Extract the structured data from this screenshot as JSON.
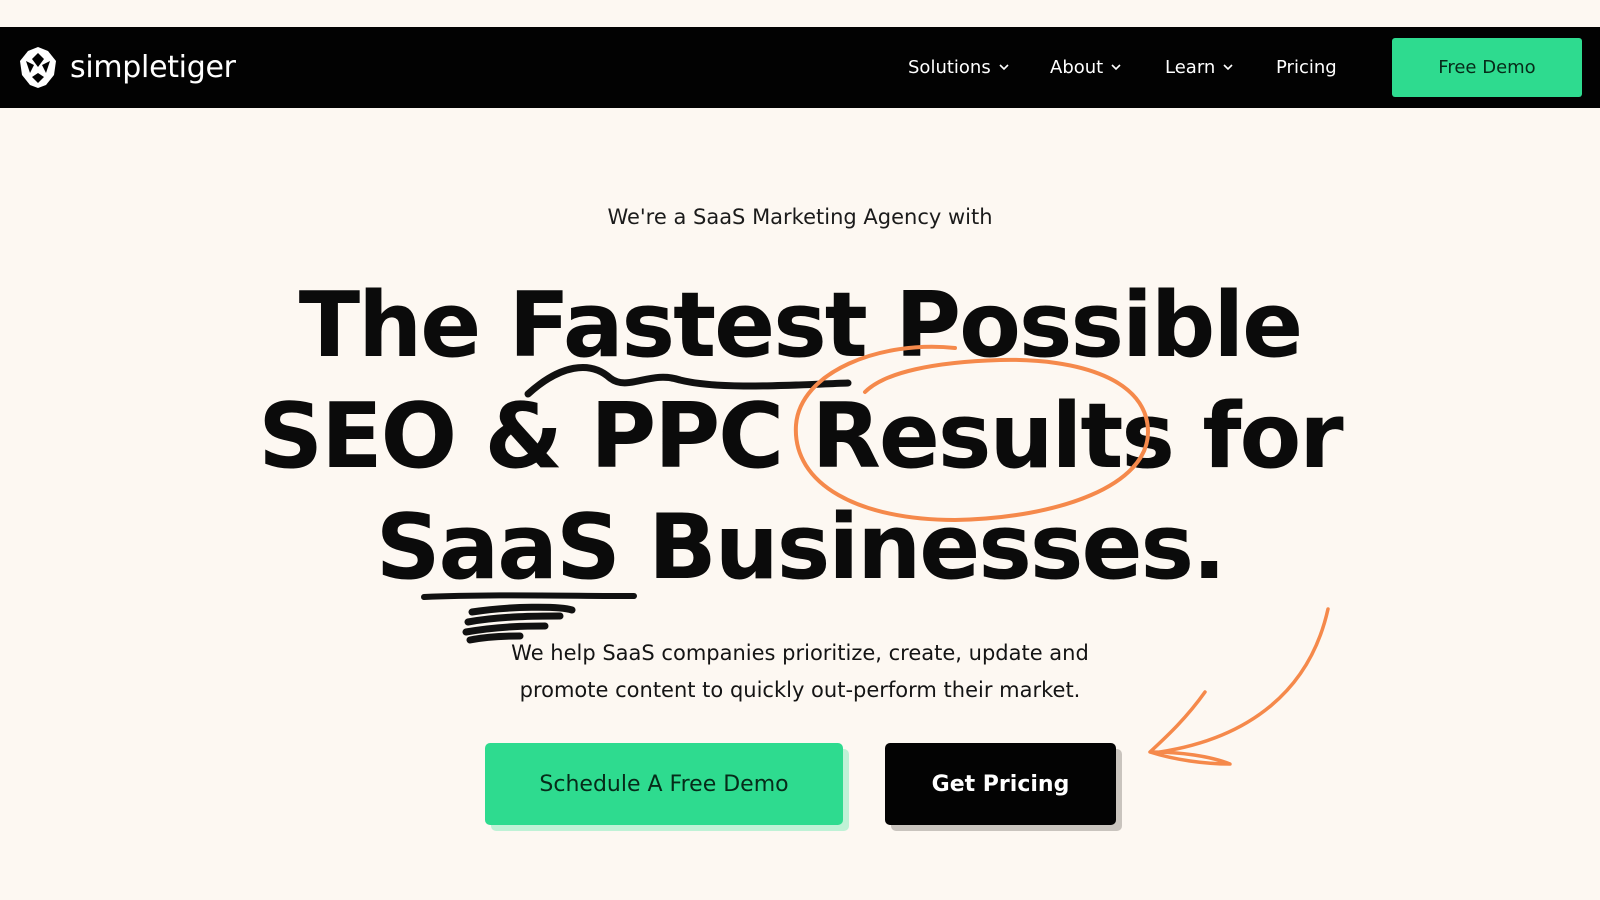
{
  "brand": {
    "name": "simpletiger",
    "logo_icon": "tiger-head-icon"
  },
  "nav": {
    "items": [
      {
        "label": "Solutions",
        "has_dropdown": true
      },
      {
        "label": "About",
        "has_dropdown": true
      },
      {
        "label": "Learn",
        "has_dropdown": true
      },
      {
        "label": "Pricing",
        "has_dropdown": false
      }
    ],
    "cta_label": "Free Demo"
  },
  "hero": {
    "eyebrow": "We're a SaaS Marketing Agency with",
    "headline_lines": [
      "The Fastest Possible",
      "SEO & PPC Results for",
      "SaaS Businesses."
    ],
    "subtext_lines": [
      "We help SaaS companies prioritize, create, update and",
      "promote content to quickly out-perform their market."
    ],
    "primary_cta": "Schedule A Free Demo",
    "secondary_cta": "Get Pricing"
  },
  "colors": {
    "background": "#fdf8f2",
    "nav_background": "#020202",
    "accent_green": "#2edb8f",
    "scribble_orange": "#f5894b",
    "scribble_black": "#111111"
  }
}
